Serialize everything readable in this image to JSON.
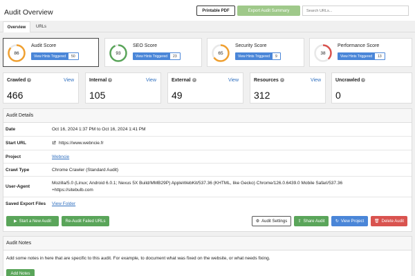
{
  "header": {
    "title": "Audit Overview",
    "printable_pdf": "Printable PDF",
    "export_summary": "Export Audit Summary",
    "search_placeholder": "Search URLs..."
  },
  "tabs": [
    {
      "label": "Overview",
      "active": true
    },
    {
      "label": "URLs",
      "active": false
    }
  ],
  "scores": [
    {
      "title": "Audit Score",
      "value": "86",
      "fraction": 0.86,
      "color": "#f0a030",
      "hints_label": "View Hints Triggered",
      "hints_count": "50",
      "active": true
    },
    {
      "title": "SEO Score",
      "value": "93",
      "fraction": 0.93,
      "color": "#5aa55a",
      "hints_label": "View Hints Triggered",
      "hints_count": "23",
      "active": false
    },
    {
      "title": "Security Score",
      "value": "65",
      "fraction": 0.65,
      "color": "#f0a030",
      "hints_label": "View Hints Triggered",
      "hints_count": "9",
      "active": false
    },
    {
      "title": "Performance Score",
      "value": "38",
      "fraction": 0.38,
      "color": "#d9534f",
      "hints_label": "View Hints Triggered",
      "hints_count": "13",
      "active": false
    }
  ],
  "stats": [
    {
      "label": "Crawled",
      "value": "466",
      "view": "View"
    },
    {
      "label": "Internal",
      "value": "105",
      "view": "View"
    },
    {
      "label": "External",
      "value": "49",
      "view": "View"
    },
    {
      "label": "Resources",
      "value": "312",
      "view": "View"
    },
    {
      "label": "Uncrawled",
      "value": "0",
      "view": ""
    }
  ],
  "details": {
    "title": "Audit Details",
    "date_label": "Date",
    "date_value": "Oct 16, 2024 1:37 PM to Oct 16, 2024 1:41 PM",
    "start_url_label": "Start URL",
    "start_url_value": "https://www.webncie.fr",
    "project_label": "Project",
    "project_value": "Webncie",
    "crawl_type_label": "Crawl Type",
    "crawl_type_value": "Chrome Crawler (Standard Audit)",
    "user_agent_label": "User-Agent",
    "user_agent_line1": "Mozilla/5.0 (Linux; Android 6.0.1; Nexus 5X Build/MMB29P) AppleWebKit/537.36 (KHTML, like Gecko) Chrome/126.0.6439.0 Mobile Safari/537.36",
    "user_agent_line2": "+https://sitebulb.com",
    "saved_exports_label": "Saved Export Files",
    "saved_exports_value": "View Folder"
  },
  "actions": {
    "start_new": "Start a New Audit",
    "re_audit": "Re-Audit Failed URLs",
    "settings": "Audit Settings",
    "share": "Share Audit",
    "view_project": "View Project",
    "delete": "Delete Audit"
  },
  "notes": {
    "title": "Audit Notes",
    "text": "Add some notes in here that are specific to this audit. For example, to document what was fixed on the website, or what needs fixing.",
    "add_button": "Add Notes"
  }
}
